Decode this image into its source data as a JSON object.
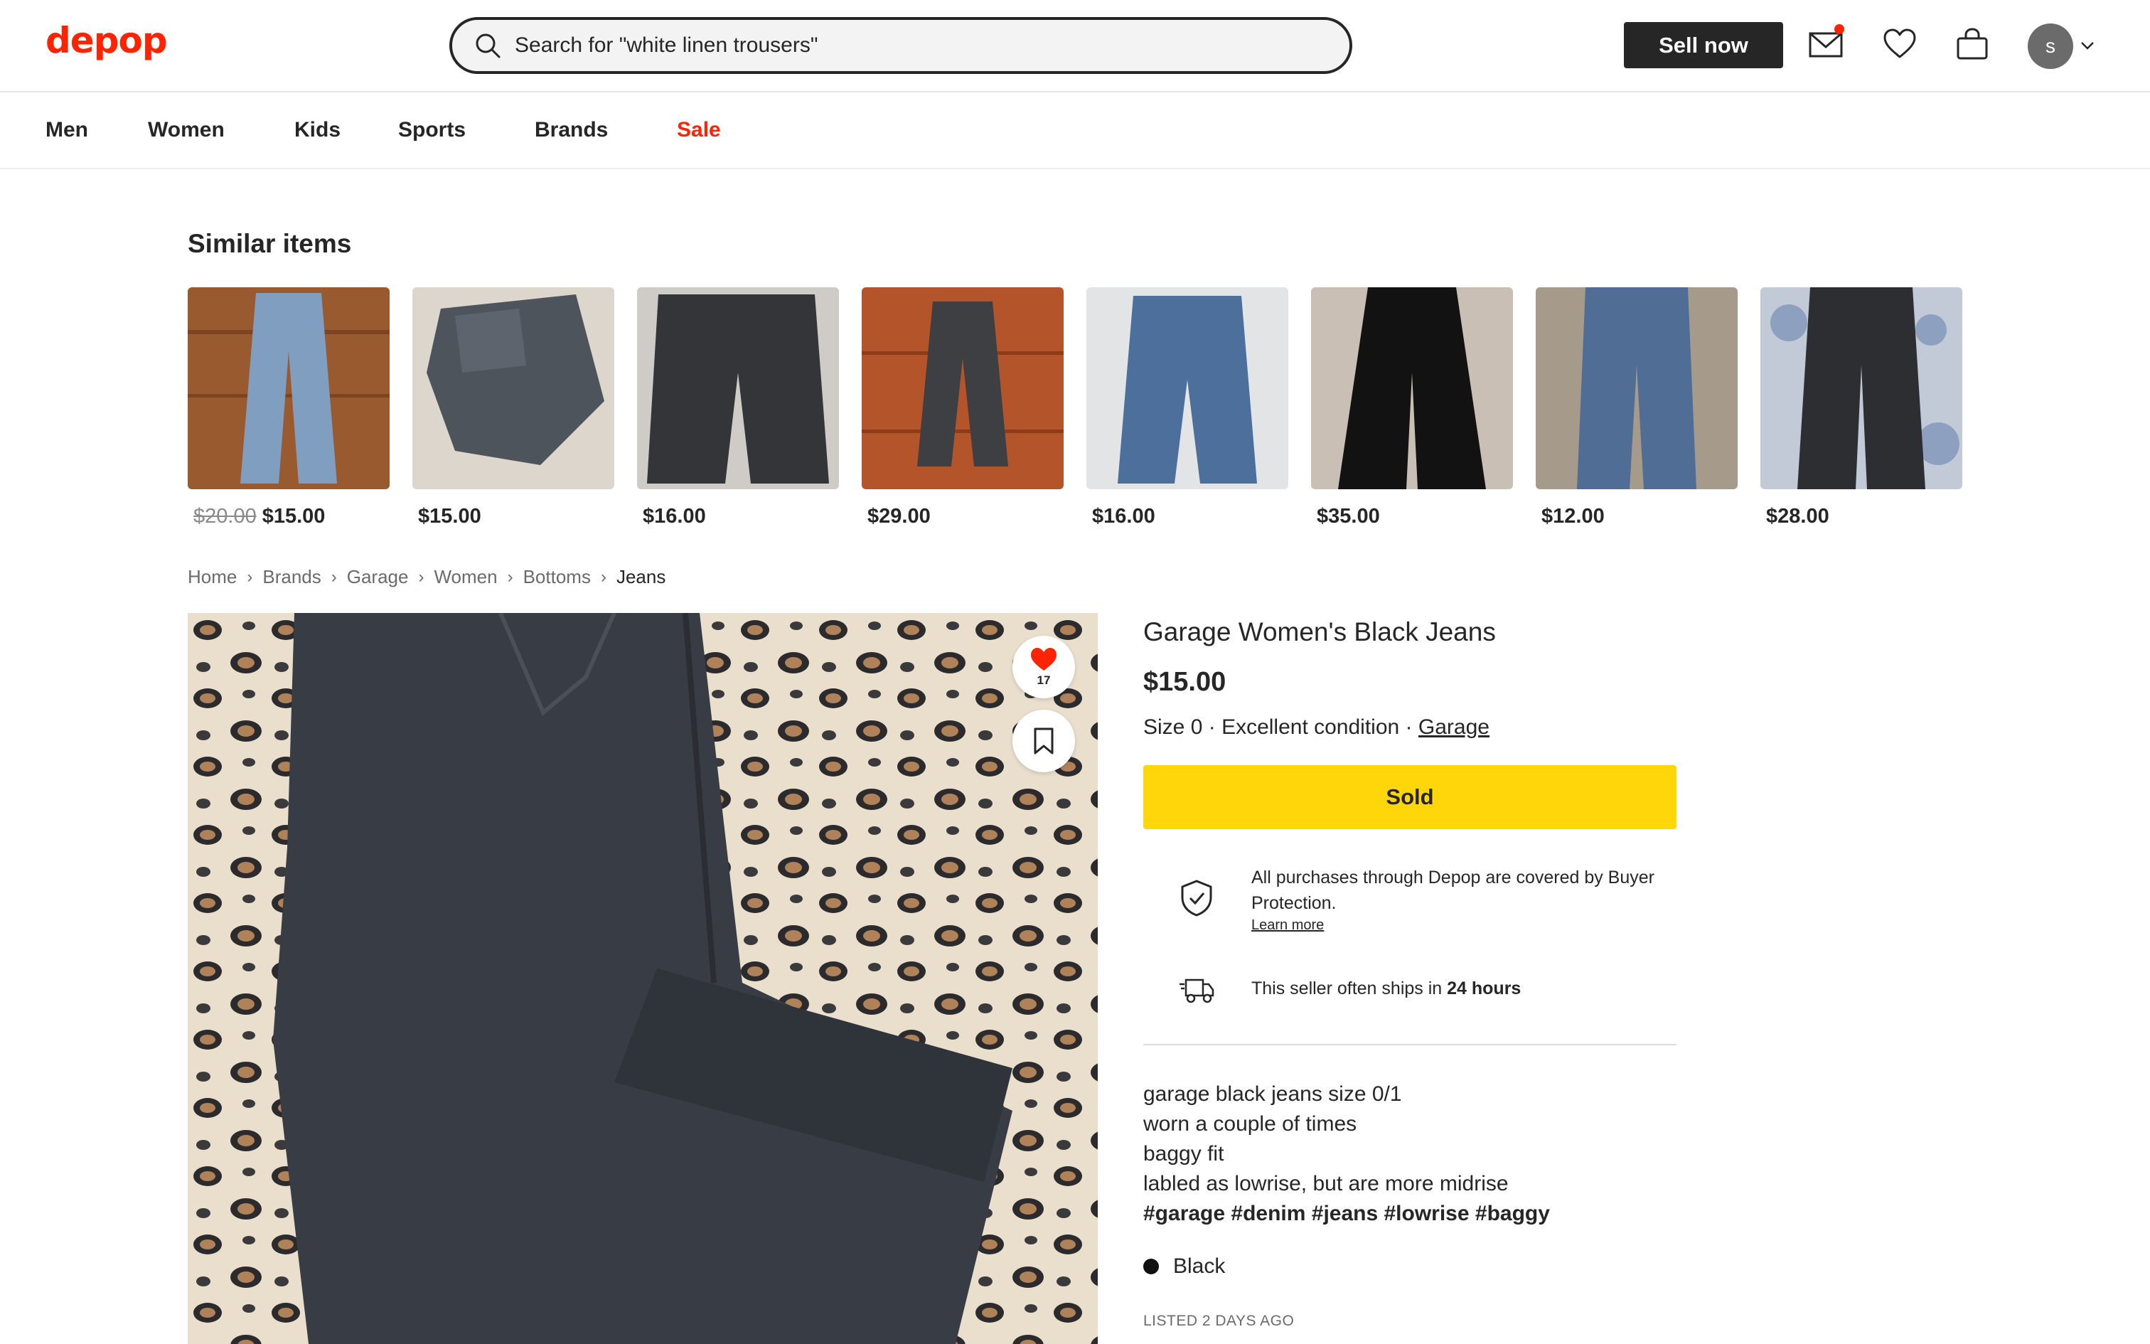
{
  "header": {
    "logo": "depop",
    "search_placeholder": "Search for \"white linen trousers\"",
    "sell_label": "Sell now",
    "avatar_initial": "s",
    "icons": [
      "search-icon",
      "mail-icon",
      "heart-icon",
      "bag-icon",
      "chevron-down-icon"
    ]
  },
  "nav": {
    "items": [
      {
        "label": "Men"
      },
      {
        "label": "Women"
      },
      {
        "label": "Kids"
      },
      {
        "label": "Sports"
      },
      {
        "label": "Brands"
      },
      {
        "label": "Sale"
      }
    ]
  },
  "similar": {
    "title": "Similar items",
    "items": [
      {
        "old_price": "$20.00",
        "price": "$15.00"
      },
      {
        "old_price": "",
        "price": "$15.00"
      },
      {
        "old_price": "",
        "price": "$16.00"
      },
      {
        "old_price": "",
        "price": "$29.00"
      },
      {
        "old_price": "",
        "price": "$16.00"
      },
      {
        "old_price": "",
        "price": "$35.00"
      },
      {
        "old_price": "",
        "price": "$12.00"
      },
      {
        "old_price": "",
        "price": "$28.00"
      }
    ]
  },
  "breadcrumb": [
    "Home",
    "Brands",
    "Garage",
    "Women",
    "Bottoms",
    "Jeans"
  ],
  "product": {
    "like_count": "17",
    "title": "Garage Women's Black Jeans",
    "price": "$15.00",
    "size": "Size 0",
    "condition": "Excellent condition",
    "brand": "Garage",
    "sold_label": "Sold",
    "protection_text": "All purchases through Depop are covered by Buyer Protection.",
    "learn_more": "Learn more",
    "shipping_text": "This seller often ships in",
    "shipping_time": "24 hours",
    "description": [
      "garage black jeans size 0/1",
      "worn a couple of times",
      "baggy fit",
      "labled as lowrise, but are more midrise"
    ],
    "hashtags": "#garage #denim #jeans #lowrise #baggy",
    "color": "Black",
    "listed": "LISTED 2 DAYS AGO"
  },
  "colors": {
    "brand_red": "#ff2300",
    "sold_yellow": "#ffd60a",
    "dark": "#262626"
  }
}
